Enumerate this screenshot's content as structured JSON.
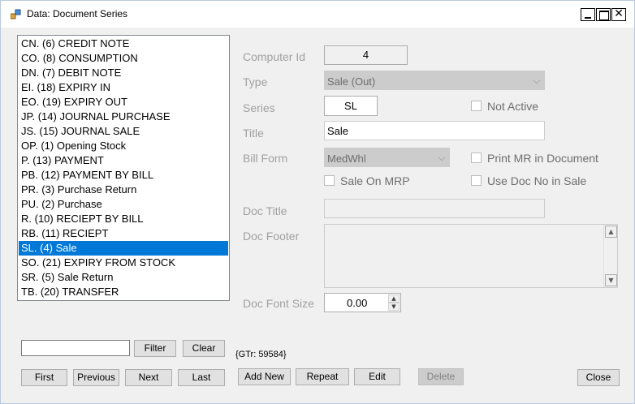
{
  "window": {
    "title": "Data: Document Series",
    "controls": {
      "minimize": "minimize-icon",
      "maximize": "maximize-icon",
      "close": "✕"
    }
  },
  "series_list": {
    "items": [
      "CN.  (6) CREDIT NOTE",
      "CO.  (8) CONSUMPTION",
      "DN.  (7) DEBIT NOTE",
      "EI.  (18) EXPIRY IN",
      "EO.  (19) EXPIRY OUT",
      "JP.  (14) JOURNAL PURCHASE",
      "JS.  (15) JOURNAL SALE",
      "OP.  (1) Opening Stock",
      "P.  (13) PAYMENT",
      "PB.  (12) PAYMENT BY BILL",
      "PR.  (3) Purchase Return",
      "PU.  (2) Purchase",
      "R.  (10) RECIEPT BY BILL",
      "RB.  (11) RECIEPT",
      "SL.  (4) Sale",
      "SO.  (21) EXPIRY FROM STOCK",
      "SR.  (5) Sale Return",
      "TB.  (20) TRANSFER"
    ],
    "selected_index": 14,
    "selection_color": "#0078d7"
  },
  "form": {
    "computer_id": {
      "label": "Computer Id",
      "value": "4"
    },
    "type": {
      "label": "Type",
      "value": "Sale (Out)"
    },
    "series": {
      "label": "Series",
      "value": "SL"
    },
    "not_active": {
      "label": "Not Active",
      "checked": false
    },
    "title": {
      "label": "Title",
      "value": "Sale"
    },
    "bill_form": {
      "label": "Bill Form",
      "value": "MedWhl"
    },
    "print_mr": {
      "label": "Print MR in Document",
      "checked": false
    },
    "sale_on_mrp": {
      "label": "Sale On MRP",
      "checked": false
    },
    "use_doc_no": {
      "label": "Use Doc No in Sale",
      "checked": false
    },
    "doc_title": {
      "label": "Doc Title",
      "value": ""
    },
    "doc_footer": {
      "label": "Doc Footer",
      "value": ""
    },
    "doc_font_size": {
      "label": "Doc Font Size",
      "value": "0.00"
    }
  },
  "filter": {
    "value": "",
    "filter_label": "Filter",
    "clear_label": "Clear",
    "gtr_text": "{GTr: 59584}"
  },
  "nav_buttons": {
    "first": "First",
    "previous": "Previous",
    "next": "Next",
    "last": "Last"
  },
  "action_buttons": {
    "add_new": "Add New",
    "repeat": "Repeat",
    "edit": "Edit",
    "delete": "Delete",
    "close": "Close"
  }
}
